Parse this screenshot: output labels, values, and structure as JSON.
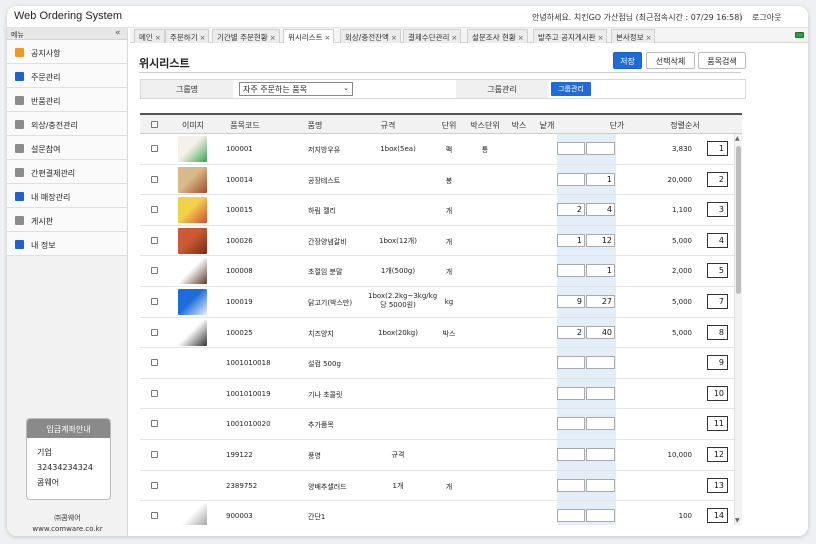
{
  "app": {
    "title": "Web Ordering System",
    "greeting": "안녕하세요. 치킨GO 가산점님 (최근접속시간 : 07/29 16:58)",
    "separator": "|",
    "logout": "로그아웃"
  },
  "sidebar": {
    "header": "메뉴",
    "collapse_glyph": "«",
    "items": [
      {
        "label": "공지사항",
        "color": "#f39a1e"
      },
      {
        "label": "주문관리",
        "color": "#1f5fd0"
      },
      {
        "label": "반품관리",
        "color": "#8c8c8c"
      },
      {
        "label": "외상/충전관리",
        "color": "#8c8c8c"
      },
      {
        "label": "설문참여",
        "color": "#8c8c8c"
      },
      {
        "label": "간편결제관리",
        "color": "#8c8c8c"
      },
      {
        "label": "내 매장관리",
        "color": "#1f5fd0"
      },
      {
        "label": "게시판",
        "color": "#8c8c8c"
      },
      {
        "label": "내 정보",
        "color": "#1f5fd0"
      }
    ],
    "bank": {
      "title": "입금계좌안내",
      "bank_name": "기업",
      "account": "32434234324",
      "holder": "콤웨어"
    },
    "company": {
      "name": "㈜콤웨어",
      "url": "www.comware.co.kr"
    }
  },
  "tabs": [
    {
      "label": "메인",
      "close": "×"
    },
    {
      "label": "주문하기",
      "close": "×"
    },
    {
      "label": "기간별 주문현황",
      "close": "×"
    },
    {
      "label": "위시리스트",
      "close": "×"
    },
    {
      "label": "외상/충전잔액",
      "close": "×"
    },
    {
      "label": "결제수단관리",
      "close": "×"
    },
    {
      "label": "설문조사 현황",
      "close": "×"
    },
    {
      "label": "발주고 공지게시판",
      "close": "×"
    },
    {
      "label": "본사정보",
      "close": "×"
    }
  ],
  "page": {
    "title": "위시리스트",
    "buttons": {
      "save": "저장",
      "delete_selected": "선택삭제",
      "product_search": "품목검색"
    },
    "filter": {
      "group_label": "그룹명",
      "group_value": "자주 주문하는 품목",
      "group_manage_label": "그룹관리",
      "group_manage_button": "그룹관리"
    }
  },
  "table": {
    "headers": [
      "이미지",
      "품목코드",
      "품명",
      "규격",
      "단위",
      "박스단위",
      "박스",
      "낱개",
      "단가",
      "정렬순서"
    ],
    "rows": [
      {
        "code": "100001",
        "name": "저지방우유",
        "spec": "1box(5ea)",
        "unit": "팩",
        "box_unit": "통",
        "box": "",
        "each": "",
        "price": "3,830",
        "order": "1",
        "img": [
          "#f4f1ea",
          "#39a34a"
        ]
      },
      {
        "code": "100014",
        "name": "공장테스트",
        "spec": "",
        "unit": "봉",
        "box_unit": "",
        "box": "",
        "each": "1",
        "price": "20,000",
        "order": "2",
        "img": [
          "#d9b98a",
          "#a04a2a"
        ]
      },
      {
        "code": "100015",
        "name": "하림 젤리",
        "spec": "",
        "unit": "개",
        "box_unit": "",
        "box": "2",
        "each": "4",
        "price": "1,100",
        "order": "3",
        "img": [
          "#f2d24a",
          "#d9463a"
        ]
      },
      {
        "code": "100026",
        "name": "간장양념갈비",
        "spec": "1box(12개)",
        "unit": "개",
        "box_unit": "",
        "box": "1",
        "each": "12",
        "price": "5,000",
        "order": "4",
        "img": [
          "#c95a32",
          "#7a2a15"
        ]
      },
      {
        "code": "100008",
        "name": "초절임 분말",
        "spec": "1개(500g)",
        "unit": "개",
        "box_unit": "",
        "box": "",
        "each": "1",
        "price": "2,000",
        "order": "5",
        "img": [
          "#ffffff",
          "#5a3a2a"
        ]
      },
      {
        "code": "100019",
        "name": "닭고기(박스만)",
        "spec": "1box(2.2kg~3kg/kg 당 5000원)",
        "unit": "kg",
        "box_unit": "",
        "box": "9",
        "each": "27",
        "price": "5,000",
        "order": "7",
        "img": [
          "#1f6cd8",
          "#e8f0ff"
        ]
      },
      {
        "code": "100025",
        "name": "치즈양지",
        "spec": "1box(20kg)",
        "unit": "박스",
        "box_unit": "",
        "box": "2",
        "each": "40",
        "price": "5,000",
        "order": "8",
        "img": [
          "#ffffff",
          "#333333"
        ]
      },
      {
        "code": "1001010018",
        "name": "설컴 500g",
        "spec": "",
        "unit": "",
        "box_unit": "",
        "box": "",
        "each": "",
        "price": "",
        "order": "9",
        "img": null
      },
      {
        "code": "1001010019",
        "name": "기나 초콜릿",
        "spec": "",
        "unit": "",
        "box_unit": "",
        "box": "",
        "each": "",
        "price": "",
        "order": "10",
        "img": null
      },
      {
        "code": "1001010020",
        "name": "추가품목",
        "spec": "",
        "unit": "",
        "box_unit": "",
        "box": "",
        "each": "",
        "price": "",
        "order": "11",
        "img": null
      },
      {
        "code": "199122",
        "name": "풍영",
        "spec": "규격",
        "unit": "",
        "box_unit": "",
        "box": "",
        "each": "",
        "price": "10,000",
        "order": "12",
        "img": null
      },
      {
        "code": "2389752",
        "name": "양배추샐러드",
        "spec": "1개",
        "unit": "개",
        "box_unit": "",
        "box": "",
        "each": "",
        "price": "",
        "order": "13",
        "img": null
      },
      {
        "code": "900003",
        "name": "간단1",
        "spec": "",
        "unit": "",
        "box_unit": "",
        "box": "",
        "each": "",
        "price": "100",
        "order": "14",
        "img": [
          "#ffffff",
          "#9a9a9a"
        ]
      }
    ]
  }
}
